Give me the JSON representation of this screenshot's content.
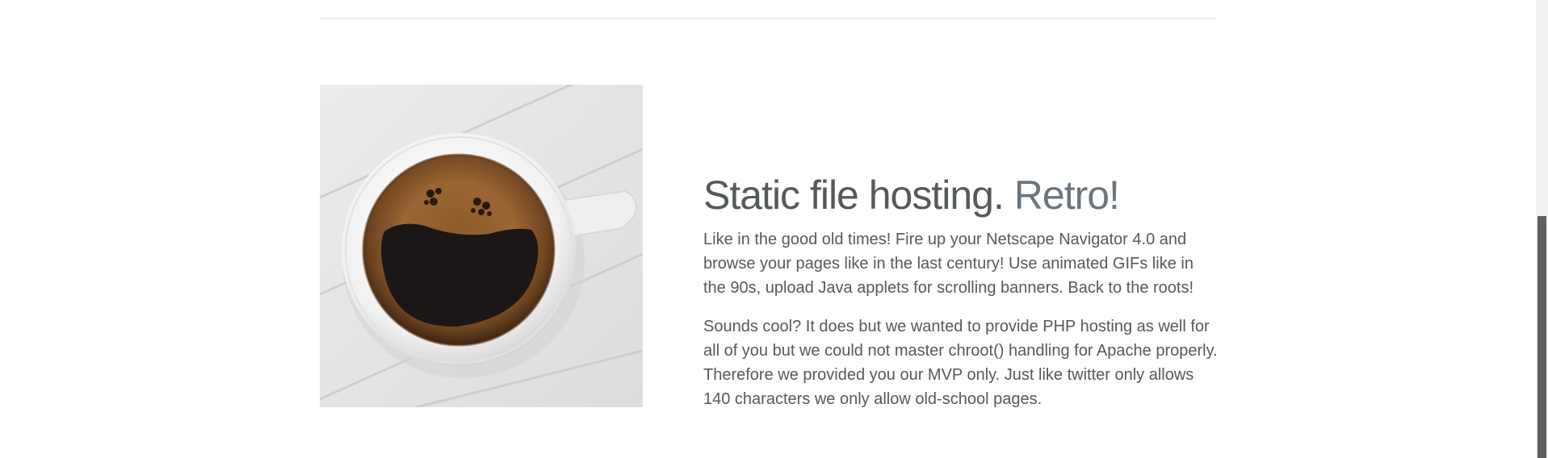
{
  "feature": {
    "heading_main": "Static file hosting.",
    "heading_muted": "Retro!",
    "paragraph_1": "Like in the good old times! Fire up your Netscape Navigator 4.0 and browse your pages like in the last century! Use animated GIFs like in the 90s, upload Java applets for scrolling banners. Back to the roots!",
    "paragraph_2": "Sounds cool? It does but we wanted to provide PHP hosting as well for all of you but we could not master chroot() handling for Apache properly. Therefore we provided you our MVP only. Just like twitter only allows 140 characters we only allow old-school pages.",
    "image": "coffee-cup-smiley-image"
  },
  "colors": {
    "heading": "#55595c",
    "heading_muted": "#6c757d",
    "text": "#55595c",
    "divider": "#eceeef"
  }
}
